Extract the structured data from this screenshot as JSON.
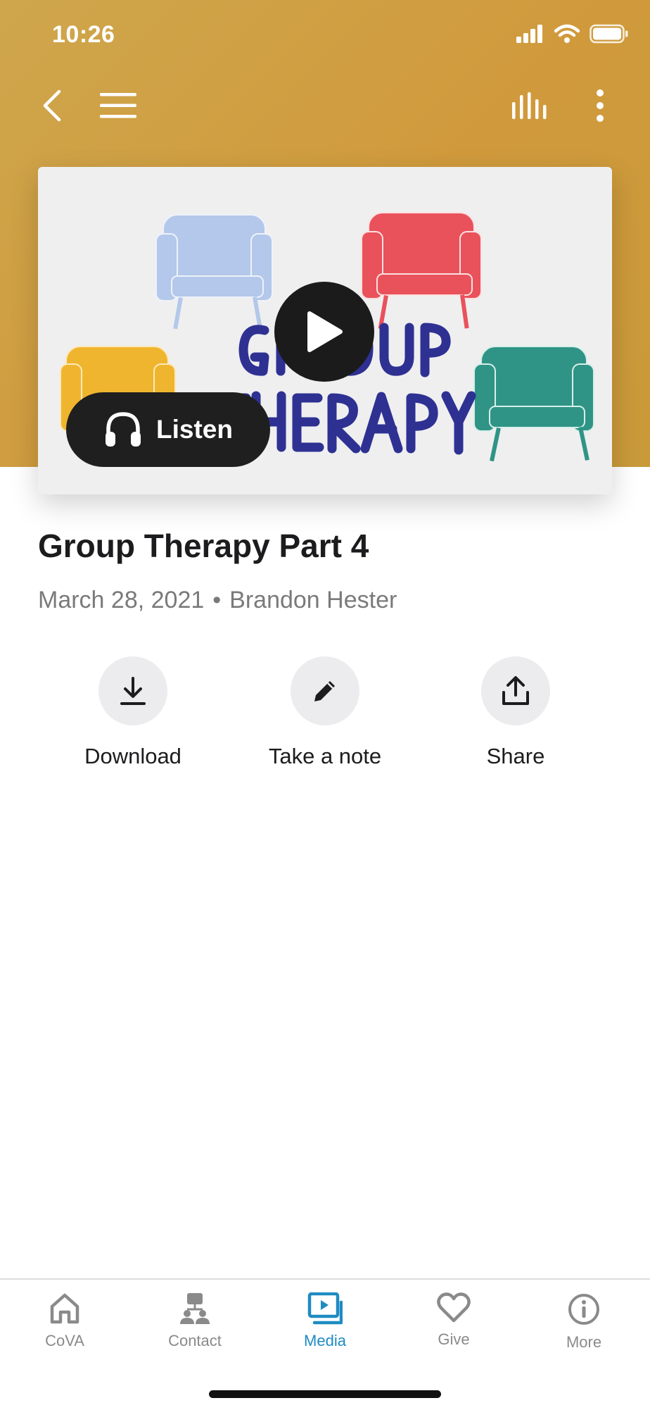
{
  "status_bar": {
    "time": "10:26"
  },
  "episode": {
    "listen_label": "Listen",
    "title": "Group Therapy Part 4",
    "date": "March 28, 2021",
    "separator": "•",
    "speaker": "Brandon Hester"
  },
  "actions": [
    {
      "label": "Download",
      "icon": "download-icon"
    },
    {
      "label": "Take a note",
      "icon": "pencil-icon"
    },
    {
      "label": "Share",
      "icon": "share-icon"
    }
  ],
  "tabs": [
    {
      "label": "CoVA",
      "icon": "home-icon",
      "active": false
    },
    {
      "label": "Contact",
      "icon": "contact-icon",
      "active": false
    },
    {
      "label": "Media",
      "icon": "media-icon",
      "active": true
    },
    {
      "label": "Give",
      "icon": "heart-icon",
      "active": false
    },
    {
      "label": "More",
      "icon": "info-icon",
      "active": false
    }
  ],
  "colors": {
    "header_gold": "#cfa64c",
    "tab_active": "#1f8bc2",
    "tab_inactive": "#8a8a8a",
    "chair_blue": "#b3c8ea",
    "chair_red": "#e9525b",
    "chair_yellow": "#f0b52e",
    "chair_teal": "#2f9486",
    "artwork_text": "#2e3192"
  }
}
